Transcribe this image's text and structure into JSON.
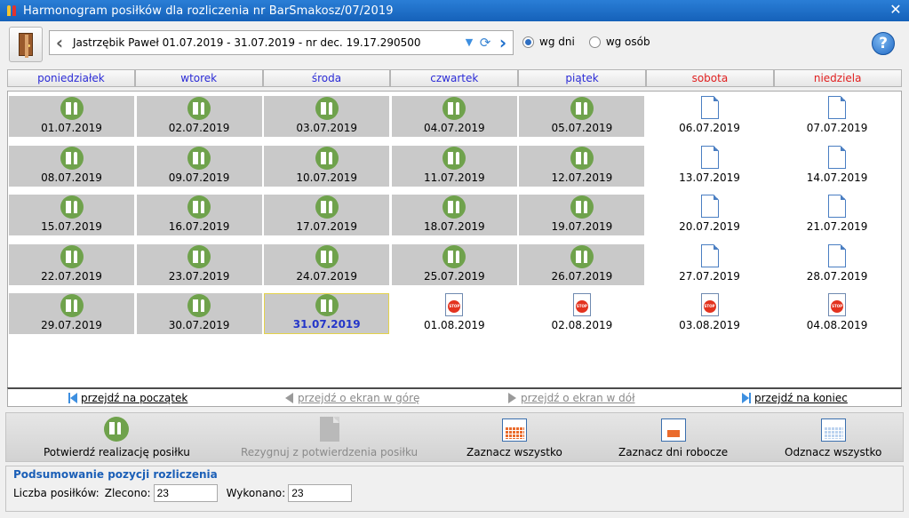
{
  "window": {
    "title": "Harmonogram posiłków  dla rozliczenia nr BarSmakosz/07/2019"
  },
  "toolbar": {
    "nav_text": "Jastrzębik Paweł 01.07.2019 - 31.07.2019 - nr dec. 19.17.290500",
    "radio_days": "wg dni",
    "radio_persons": "wg osób",
    "radio_selected": "wg dni",
    "help": "?"
  },
  "days": [
    {
      "label": "poniedziałek",
      "weekend": false
    },
    {
      "label": "wtorek",
      "weekend": false
    },
    {
      "label": "środa",
      "weekend": false
    },
    {
      "label": "czwartek",
      "weekend": false
    },
    {
      "label": "piątek",
      "weekend": false
    },
    {
      "label": "sobota",
      "weekend": true
    },
    {
      "label": "niedziela",
      "weekend": true
    }
  ],
  "calendar": {
    "rows": [
      [
        {
          "date": "01.07.2019",
          "type": "meal"
        },
        {
          "date": "02.07.2019",
          "type": "meal"
        },
        {
          "date": "03.07.2019",
          "type": "meal"
        },
        {
          "date": "04.07.2019",
          "type": "meal"
        },
        {
          "date": "05.07.2019",
          "type": "meal"
        },
        {
          "date": "06.07.2019",
          "type": "doc"
        },
        {
          "date": "07.07.2019",
          "type": "doc"
        }
      ],
      [
        {
          "date": "08.07.2019",
          "type": "meal"
        },
        {
          "date": "09.07.2019",
          "type": "meal"
        },
        {
          "date": "10.07.2019",
          "type": "meal"
        },
        {
          "date": "11.07.2019",
          "type": "meal"
        },
        {
          "date": "12.07.2019",
          "type": "meal"
        },
        {
          "date": "13.07.2019",
          "type": "doc"
        },
        {
          "date": "14.07.2019",
          "type": "doc"
        }
      ],
      [
        {
          "date": "15.07.2019",
          "type": "meal"
        },
        {
          "date": "16.07.2019",
          "type": "meal"
        },
        {
          "date": "17.07.2019",
          "type": "meal"
        },
        {
          "date": "18.07.2019",
          "type": "meal"
        },
        {
          "date": "19.07.2019",
          "type": "meal"
        },
        {
          "date": "20.07.2019",
          "type": "doc"
        },
        {
          "date": "21.07.2019",
          "type": "doc"
        }
      ],
      [
        {
          "date": "22.07.2019",
          "type": "meal"
        },
        {
          "date": "23.07.2019",
          "type": "meal"
        },
        {
          "date": "24.07.2019",
          "type": "meal"
        },
        {
          "date": "25.07.2019",
          "type": "meal"
        },
        {
          "date": "26.07.2019",
          "type": "meal"
        },
        {
          "date": "27.07.2019",
          "type": "doc"
        },
        {
          "date": "28.07.2019",
          "type": "doc"
        }
      ],
      [
        {
          "date": "29.07.2019",
          "type": "meal"
        },
        {
          "date": "30.07.2019",
          "type": "meal"
        },
        {
          "date": "31.07.2019",
          "type": "meal",
          "selected": true
        },
        {
          "date": "01.08.2019",
          "type": "stop"
        },
        {
          "date": "02.08.2019",
          "type": "stop"
        },
        {
          "date": "03.08.2019",
          "type": "stop"
        },
        {
          "date": "04.08.2019",
          "type": "stop"
        }
      ]
    ]
  },
  "navlinks": {
    "first": "przejdź na początek",
    "up": "przejdź o ekran w górę",
    "down": "przejdź o ekran w dół",
    "last": "przejdź na koniec"
  },
  "actions": {
    "confirm": "Potwierdź realizację posiłku",
    "resign": "Rezygnuj z potwierdzenia posiłku",
    "select_all": "Zaznacz wszystko",
    "select_workdays": "Zaznacz dni robocze",
    "deselect_all": "Odznacz wszystko"
  },
  "summary": {
    "legend": "Podsumowanie pozycji rozliczenia",
    "meals_label": "Liczba posiłków:",
    "ordered_label": "Zlecono:",
    "ordered_value": "23",
    "done_label": "Wykonano:",
    "done_value": "23"
  },
  "colors": {
    "meal_cell": "#c9c9c9",
    "meal_icon": "#6fa24c",
    "weekday_header": "#2b2bd6",
    "weekend_header": "#e02020",
    "selected_date": "#2436c9"
  }
}
